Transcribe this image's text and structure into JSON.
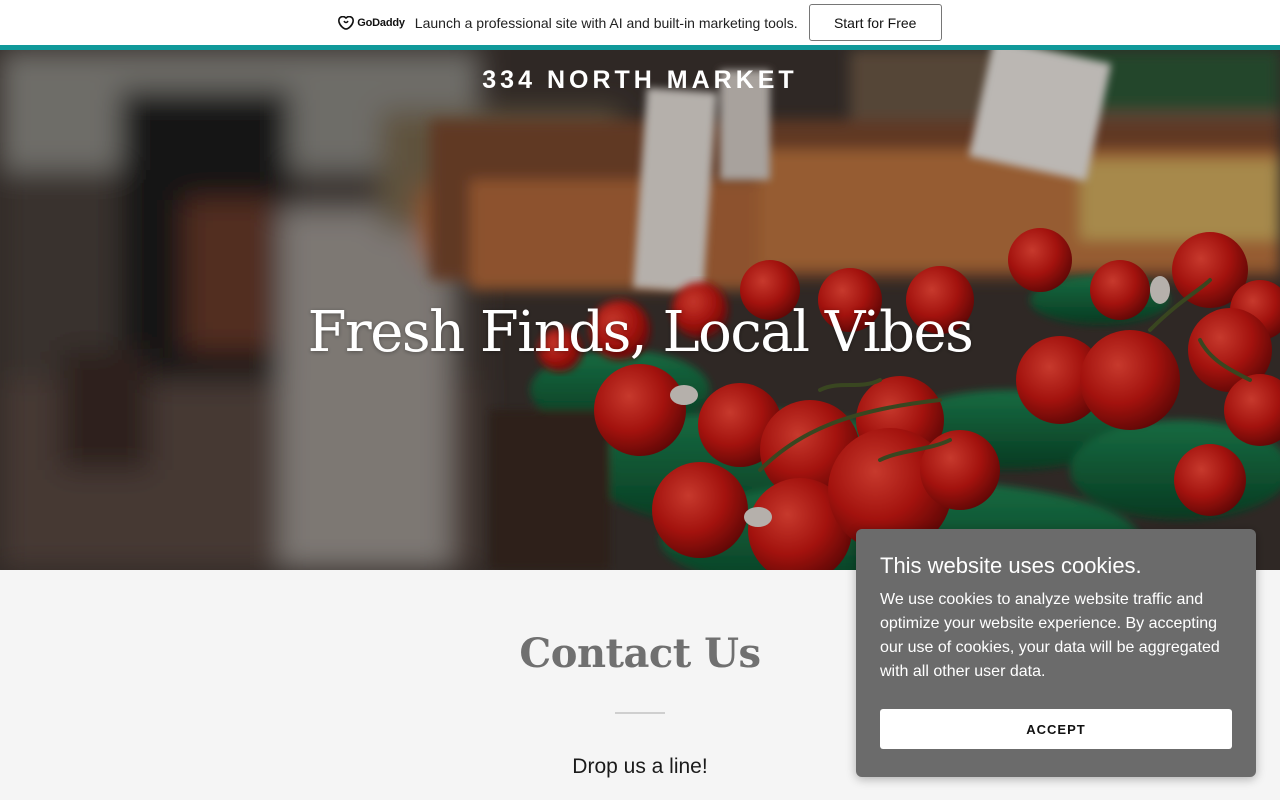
{
  "promo": {
    "logo_text": "GoDaddy",
    "logo_icon": "godaddy-logo-icon",
    "message": "Launch a professional site with AI and built-in marketing tools.",
    "cta_label": "Start for Free",
    "accent_color": "#10999a"
  },
  "hero": {
    "site_title": "334 NORTH MARKET",
    "heading": "Fresh Finds, Local Vibes"
  },
  "contact": {
    "title": "Contact Us",
    "subtitle": "Drop us a line!"
  },
  "cookie": {
    "title": "This website uses cookies.",
    "body": "We use cookies to analyze website traffic and optimize your website experience. By accepting our use of cookies, your data will be aggregated with all other user data.",
    "accept_label": "ACCEPT"
  }
}
